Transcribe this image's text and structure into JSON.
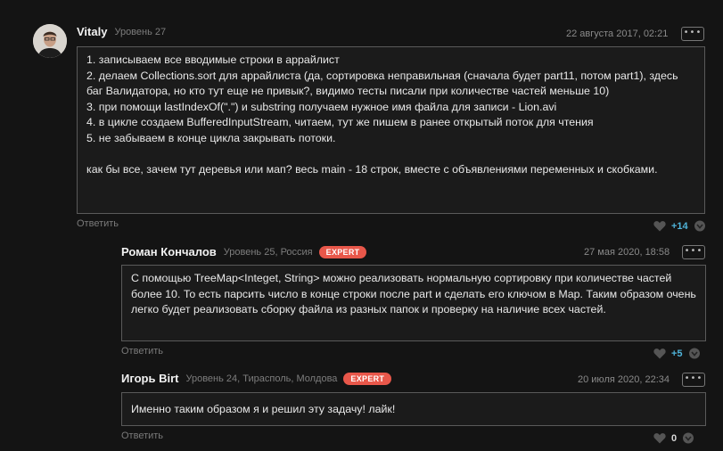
{
  "comments": [
    {
      "author": "Vitaly",
      "level": "Уровень 27",
      "location": "",
      "badge": "",
      "date": "22 августа 2017, 02:21",
      "more": "•••",
      "lines": [
        "1. записываем все вводимые строки в аррайлист",
        "2. делаем Collections.sort для аррайлиста (да, сортировка неправильная (сначала будет part11, потом part1), здесь баг Валидатора, но кто тут еще не привык?, видимо тесты писали при количестве частей меньше 10)",
        "3. при помощи lastIndexOf(\".\") и substring получаем нужное имя файла для записи - Lion.avi",
        "4. в цикле создаем BufferedInputStream, читаем, тут же пишем в ранее открытый поток для чтения",
        "5. не забываем в конце цикла закрывать потоки."
      ],
      "closing": "как бы все, зачем тут деревья или мап? весь main - 18 строк, вместе с объявлениями переменных и скобками.",
      "reply": "Ответить",
      "likes": "+14"
    },
    {
      "author": "Роман Кончалов",
      "level": "Уровень 25, ",
      "location": "Россия",
      "badge": "EXPERT",
      "date": "27 мая 2020, 18:58",
      "more": "•••",
      "text": "С помощью TreeMap<Integet, String> можно реализовать нормальную сортировку при количестве частей более 10. То есть парсить число в конце строки после part и сделать его ключом в Map. Таким образом очень легко будет реализовать сборку файла из разных папок и проверку на наличие всех частей.",
      "reply": "Ответить",
      "likes": "+5"
    },
    {
      "author": "Игорь Birt",
      "level": "Уровень 24, ",
      "location": "Тирасполь, Молдова",
      "badge": "EXPERT",
      "date": "20 июля 2020, 22:34",
      "more": "•••",
      "text": "Именно таким образом я и решил эту задачу! лайк!",
      "reply": "Ответить",
      "likes": "0"
    }
  ]
}
